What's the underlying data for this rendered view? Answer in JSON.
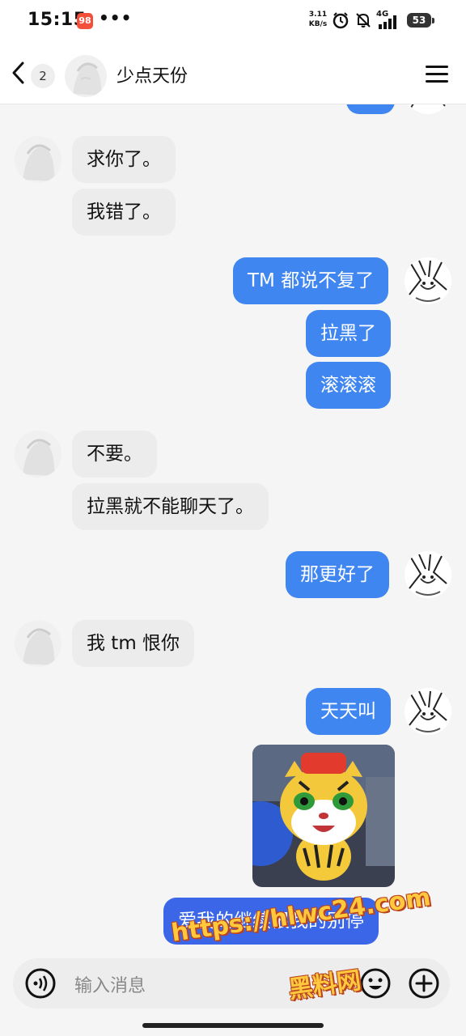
{
  "status_bar": {
    "time": "15:15",
    "app_badge": "98",
    "more": "•••",
    "net_speed": "3.11\nKB/s",
    "network": "4G",
    "battery": "53"
  },
  "header": {
    "unread_count": "2",
    "contact_name": "少点天份"
  },
  "messages": [
    {
      "side": "in",
      "text": "求你了。"
    },
    {
      "side": "in",
      "text": "我错了。"
    },
    {
      "side": "out",
      "text": "TM 都说不复了"
    },
    {
      "side": "out",
      "text": "拉黑了"
    },
    {
      "side": "out",
      "text": "滚滚滚"
    },
    {
      "side": "in",
      "text": "不要。"
    },
    {
      "side": "in",
      "text": "拉黑就不能聊天了。"
    },
    {
      "side": "out",
      "text": "那更好了"
    },
    {
      "side": "in",
      "text": "我 tm 恨你"
    },
    {
      "side": "out",
      "text": "天天叫"
    },
    {
      "side": "out",
      "type": "sticker",
      "icon": "cartoon-tiger-sticker"
    },
    {
      "side": "out",
      "text": "爱我的继续恨我的别停"
    }
  ],
  "input": {
    "placeholder": "输入消息"
  },
  "watermark": {
    "url": "https://hlwc24.com",
    "name": "黑料网"
  },
  "colors": {
    "outgoing_bubble": "#3f86f0",
    "outgoing_bubble_last": "#3b66e8",
    "incoming_bubble": "#ececec",
    "background": "#f5f5f5"
  },
  "icons": [
    "back-icon",
    "menu-icon",
    "voice-icon",
    "emoji-icon",
    "plus-icon"
  ]
}
